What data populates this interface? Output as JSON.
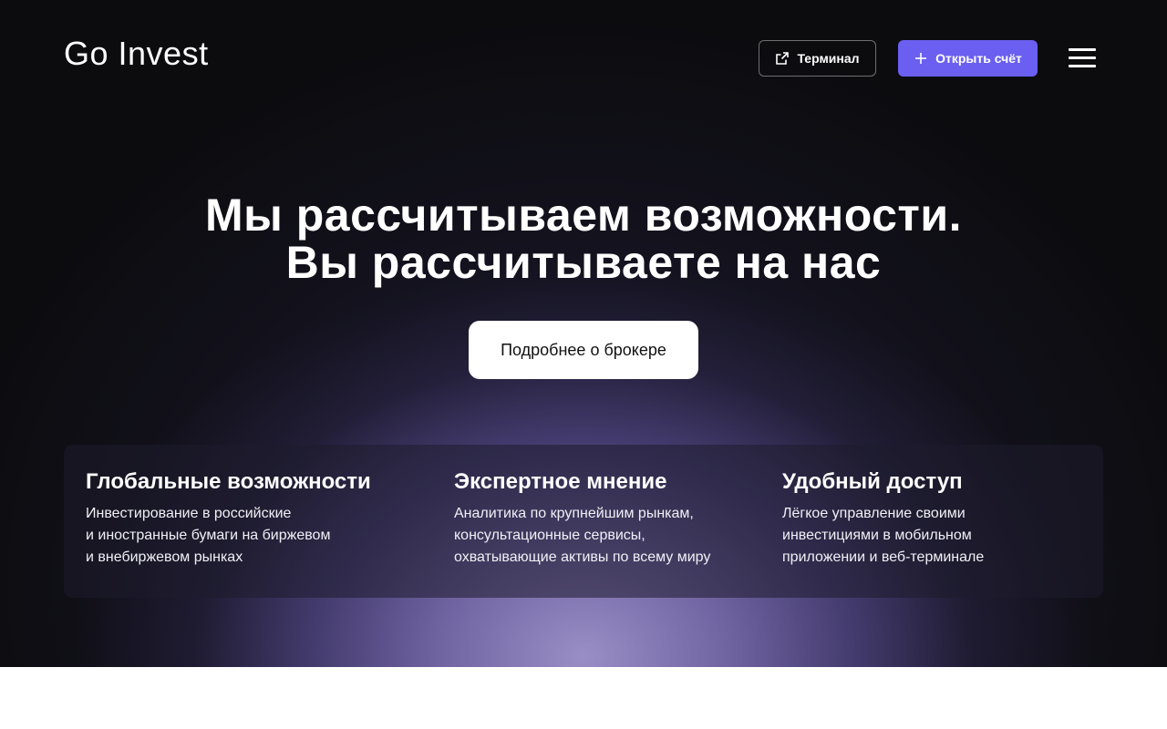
{
  "header": {
    "logo": "Go Invest",
    "terminal_label": "Терминал",
    "open_account_label": "Открыть счёт"
  },
  "hero": {
    "headline_line1": "Мы рассчитываем возможности.",
    "headline_line2": "Вы рассчитываете на нас",
    "cta_label": "Подробнее о брокере"
  },
  "features": [
    {
      "title": "Глобальные возможности",
      "text": "Инвестирование в российские\nи иностранные бумаги на биржевом\nи внебиржевом рынках"
    },
    {
      "title": "Экспертное мнение",
      "text": "Аналитика по крупнейшим рынкам,\nконсультационные сервисы,\nохватывающие активы по всему миру"
    },
    {
      "title": "Удобный доступ",
      "text": "Лёгкое управление своими\nинвестициями в мобильном\nприложении и веб-терминале"
    }
  ],
  "colors": {
    "accent": "#6a5ff0",
    "background": "#0c0c0f",
    "glow": "#9a8fd0"
  },
  "icons": {
    "terminal": "external-link-icon",
    "open_account": "plus-icon",
    "menu": "hamburger-menu-icon"
  }
}
